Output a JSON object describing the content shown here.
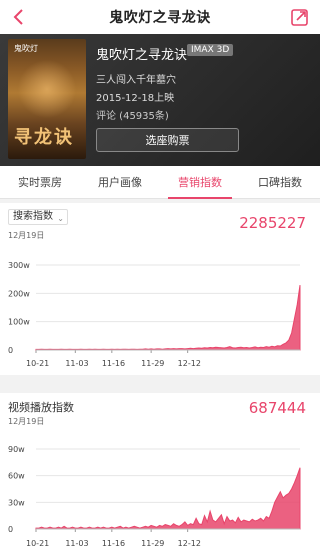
{
  "header": {
    "title": "鬼吹灯之寻龙诀"
  },
  "movie": {
    "title": "鬼吹灯之寻龙诀",
    "format": "IMAX 3D",
    "tagline": "三人闯入千年墓穴",
    "release": "2015-12-18上映",
    "reviews": "评论 (45935条)",
    "buy_label": "选座购票",
    "poster_text": "寻龙诀",
    "poster_top": "鬼吹灯"
  },
  "tabs": [
    {
      "label": "实时票房"
    },
    {
      "label": "用户画像"
    },
    {
      "label": "营销指数"
    },
    {
      "label": "口碑指数"
    }
  ],
  "colors": {
    "accent": "#e8456b"
  },
  "search_card": {
    "select_label": "搜索指数",
    "date": "12月19日",
    "value": "2285227"
  },
  "video_card": {
    "title": "视频播放指数",
    "date": "12月19日",
    "value": "687444"
  },
  "chart_data": [
    {
      "type": "area",
      "ylabels": [
        "300w",
        "200w",
        "100w",
        "0"
      ],
      "ylim": [
        0,
        300
      ],
      "xlabels": [
        "10-21",
        "11-03",
        "11-16",
        "11-29",
        "12-12"
      ],
      "values": [
        2,
        2,
        3,
        2,
        2,
        3,
        2,
        2,
        2,
        3,
        2,
        2,
        3,
        2,
        2,
        2,
        3,
        2,
        2,
        3,
        2,
        3,
        2,
        2,
        3,
        2,
        2,
        3,
        2,
        3,
        2,
        3,
        3,
        2,
        3,
        3,
        2,
        3,
        3,
        4,
        3,
        4,
        3,
        4,
        4,
        3,
        4,
        5,
        4,
        5,
        4,
        5,
        5,
        4,
        5,
        6,
        5,
        6,
        7,
        6,
        8,
        7,
        9,
        8,
        10,
        9,
        8,
        7,
        9,
        12,
        8,
        7,
        9,
        10,
        8,
        9,
        7,
        9,
        11,
        8,
        10,
        9,
        12,
        10,
        13,
        11,
        15,
        14,
        20,
        25,
        35,
        60,
        110,
        160,
        229
      ]
    },
    {
      "type": "area",
      "ylabels": [
        "90w",
        "60w",
        "30w",
        "0"
      ],
      "ylim": [
        0,
        90
      ],
      "xlabels": [
        "10-21",
        "11-03",
        "11-16",
        "11-29",
        "12-12"
      ],
      "values": [
        1,
        1,
        2,
        1,
        1,
        2,
        1,
        1,
        2,
        1,
        3,
        1,
        1,
        2,
        1,
        1,
        2,
        1,
        1,
        2,
        1,
        1,
        2,
        1,
        2,
        1,
        1,
        2,
        1,
        2,
        3,
        1,
        2,
        1,
        2,
        3,
        2,
        1,
        2,
        3,
        2,
        4,
        3,
        2,
        4,
        3,
        5,
        4,
        3,
        6,
        4,
        3,
        5,
        8,
        4,
        6,
        5,
        12,
        6,
        5,
        15,
        8,
        20,
        10,
        8,
        12,
        16,
        6,
        14,
        9,
        10,
        7,
        13,
        8,
        10,
        9,
        8,
        11,
        9,
        10,
        12,
        9,
        14,
        12,
        20,
        30,
        36,
        42,
        35,
        38,
        40,
        45,
        52,
        60,
        69
      ]
    }
  ]
}
